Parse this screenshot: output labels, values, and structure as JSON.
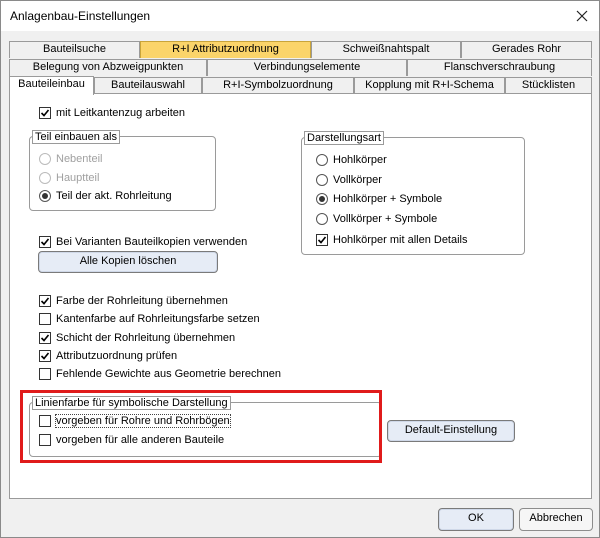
{
  "window": {
    "title": "Anlagenbau-Einstellungen"
  },
  "tabs": {
    "row1": [
      "Bauteilsuche",
      "R+I Attributzuordnung",
      "Schweißnahtspalt",
      "Gerades Rohr"
    ],
    "row2": [
      "Belegung von Abzweigpunkten",
      "Verbindungselemente",
      "Flanschverschraubung"
    ],
    "row3": [
      "Bauteileinbau",
      "Bauteilauswahl",
      "R+I-Symbolzuordnung",
      "Kopplung mit R+I-Schema",
      "Stücklisten"
    ]
  },
  "panel": {
    "leitkante": {
      "label": "mit Leitkantenzug arbeiten",
      "checked": true
    },
    "teil_einbauen": {
      "title": "Teil einbauen als",
      "options": [
        "Nebenteil",
        "Hauptteil",
        "Teil der akt. Rohrleitung"
      ]
    },
    "darstellungsart": {
      "title": "Darstellungsart",
      "options": [
        "Hohlkörper",
        "Vollkörper",
        "Hohlkörper + Symbole",
        "Vollkörper + Symbole"
      ],
      "details_label": "Hohlkörper mit allen Details"
    },
    "varianten": {
      "label": "Bei Varianten Bauteilkopien verwenden",
      "checked": true
    },
    "alle_kopien_button": "Alle Kopien löschen",
    "options": [
      {
        "label": "Farbe der Rohrleitung übernehmen",
        "checked": true
      },
      {
        "label": "Kantenfarbe auf Rohrleitungsfarbe setzen",
        "checked": false
      },
      {
        "label": "Schicht der Rohrleitung übernehmen",
        "checked": true
      },
      {
        "label": "Attributzuordnung prüfen",
        "checked": true
      },
      {
        "label": "Fehlende Gewichte aus Geometrie berechnen",
        "checked": false
      }
    ],
    "linienfarbe": {
      "title": "Linienfarbe für symbolische Darstellung",
      "opt1": "vorgeben für Rohre und Rohrbögen",
      "opt2": "vorgeben für alle anderen Bauteile"
    },
    "default_button": "Default-Einstellung"
  },
  "footer": {
    "ok": "OK",
    "cancel": "Abbrechen"
  },
  "colors": {
    "highlight_tab": "#fbd46a",
    "annotation_border": "#e01b1b"
  }
}
